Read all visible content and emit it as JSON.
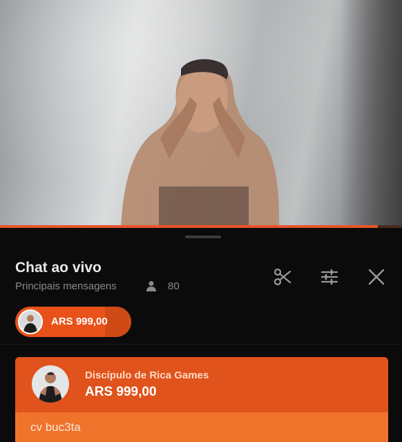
{
  "video": {
    "progress_fraction": 0.94
  },
  "chat": {
    "title": "Chat ao vivo",
    "subtitle": "Principais mensagens",
    "viewer_count": "80"
  },
  "toolbar": {
    "clip_icon": "scissors-icon",
    "filter_icon": "sliders-icon",
    "close_icon": "close-icon"
  },
  "pinned_super_chat": {
    "amount": "ARS 999,00"
  },
  "super_chat": {
    "author": "Discípulo de Rica Games",
    "amount": "ARS 999,00",
    "message": "cv buc3ta"
  },
  "colors": {
    "accent": "#e8521a",
    "card_top": "#e0531c",
    "card_bottom": "#f0732c",
    "background": "#0b0b0c"
  }
}
